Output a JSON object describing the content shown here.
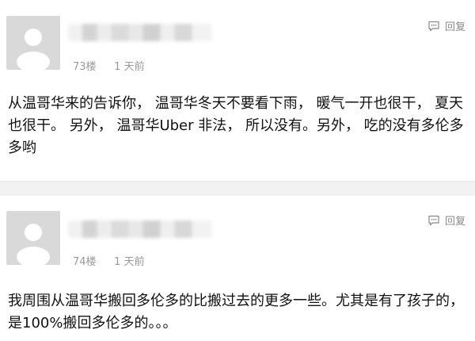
{
  "posts": [
    {
      "floor": "73楼",
      "time": "1 天前",
      "reply_label": "回复",
      "content": "从温哥华来的告诉你， 温哥华冬天不要看下雨， 暖气一开也很干， 夏天也很干。 另外， 温哥华Uber 非法， 所以没有。另外， 吃的没有多伦多多哟"
    },
    {
      "floor": "74楼",
      "time": "1 天前",
      "reply_label": "回复",
      "content": "我周围从温哥华搬回多伦多的比搬过去的更多一些。尤其是有了孩子的，是100%搬回多伦多的。。。"
    }
  ],
  "icons": {
    "avatar": "default-avatar-icon",
    "reply": "comment-bubble-icon"
  },
  "colors": {
    "meta_text": "#999999",
    "body_text": "#111111",
    "avatar_bg": "#d9d9d9",
    "divider": "#f2f2f2"
  }
}
